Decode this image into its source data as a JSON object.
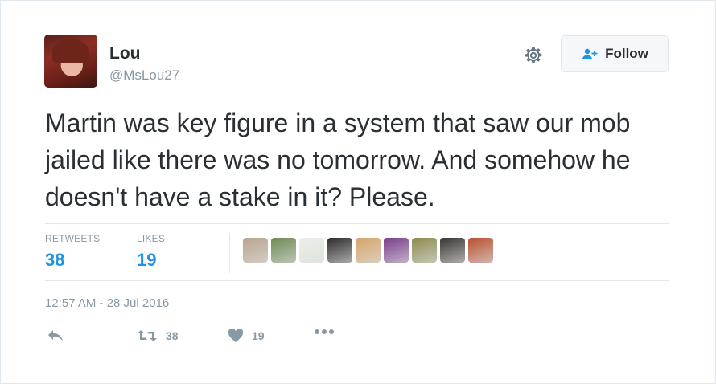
{
  "tweet": {
    "author_name": "Lou",
    "author_handle": "@MsLou27",
    "follow_label": "Follow",
    "text": "Martin was key figure in a system that saw our mob jailed like there was no tomorrow. And somehow he doesn't have a stake in it? Please.",
    "stats": {
      "retweets_label": "RETWEETS",
      "retweets_count": "38",
      "likes_label": "LIKES",
      "likes_count": "19"
    },
    "timestamp": "12:57 AM - 28 Jul 2016",
    "actions": {
      "retweet_count": "38",
      "like_count": "19"
    },
    "liker_avatars": [
      "#b9a48c",
      "#6d8a52",
      "#e9f0e6",
      "#2b2b2b",
      "#d6a46a",
      "#7b3d8c",
      "#8c8a4e",
      "#3a3430",
      "#b9502e"
    ],
    "colors": {
      "link_blue": "#1b95e0",
      "muted": "#8899a6",
      "text": "#292f33",
      "border": "#e1e8ed"
    },
    "icons": [
      "gear-icon",
      "add-user-icon",
      "reply-icon",
      "retweet-icon",
      "heart-icon",
      "more-icon"
    ]
  }
}
